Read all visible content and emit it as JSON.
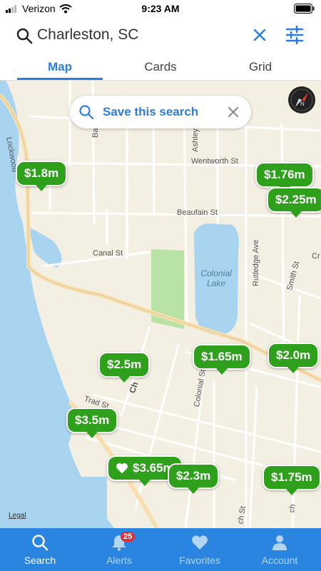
{
  "status_bar": {
    "carrier": "Verizon",
    "time": "9:23 AM"
  },
  "search": {
    "query": "Charleston, SC"
  },
  "view_tabs": [
    "Map",
    "Cards",
    "Grid"
  ],
  "active_view_tab": "Map",
  "save_search": {
    "label": "Save this search"
  },
  "map": {
    "streets": [
      "Lockwood",
      "Barre St",
      "Ashley",
      "Wentworth St",
      "Beaufain St",
      "Canal St",
      "Rutledge Ave",
      "Smith St",
      "Cr",
      "Colonial St",
      "Trad St",
      "Ch",
      "ch St",
      "ch"
    ],
    "lake_name": "Colonial Lake",
    "legal": "Legal"
  },
  "listings": [
    {
      "price": "$1.8m",
      "favorite": false
    },
    {
      "price": "$1.76m",
      "favorite": false
    },
    {
      "price": "$2.25m",
      "favorite": false
    },
    {
      "price": "$2.5m",
      "favorite": false
    },
    {
      "price": "$1.65m",
      "favorite": false
    },
    {
      "price": "$2.0m",
      "favorite": false
    },
    {
      "price": "$3.5m",
      "favorite": false
    },
    {
      "price": "$3.65m",
      "favorite": true
    },
    {
      "price": "$2.3m",
      "favorite": false
    },
    {
      "price": "$1.75m",
      "favorite": false
    }
  ],
  "bottom_nav": [
    {
      "label": "Search",
      "icon": "search-icon",
      "active": true
    },
    {
      "label": "Alerts",
      "icon": "bell-icon",
      "badge": "25"
    },
    {
      "label": "Favorites",
      "icon": "heart-icon"
    },
    {
      "label": "Account",
      "icon": "person-icon"
    }
  ],
  "colors": {
    "accent": "#2b7de1",
    "pin": "#2ea01b",
    "water": "#a8d4f0",
    "park": "#b9e3a6",
    "tabbar": "#2a85e0"
  }
}
